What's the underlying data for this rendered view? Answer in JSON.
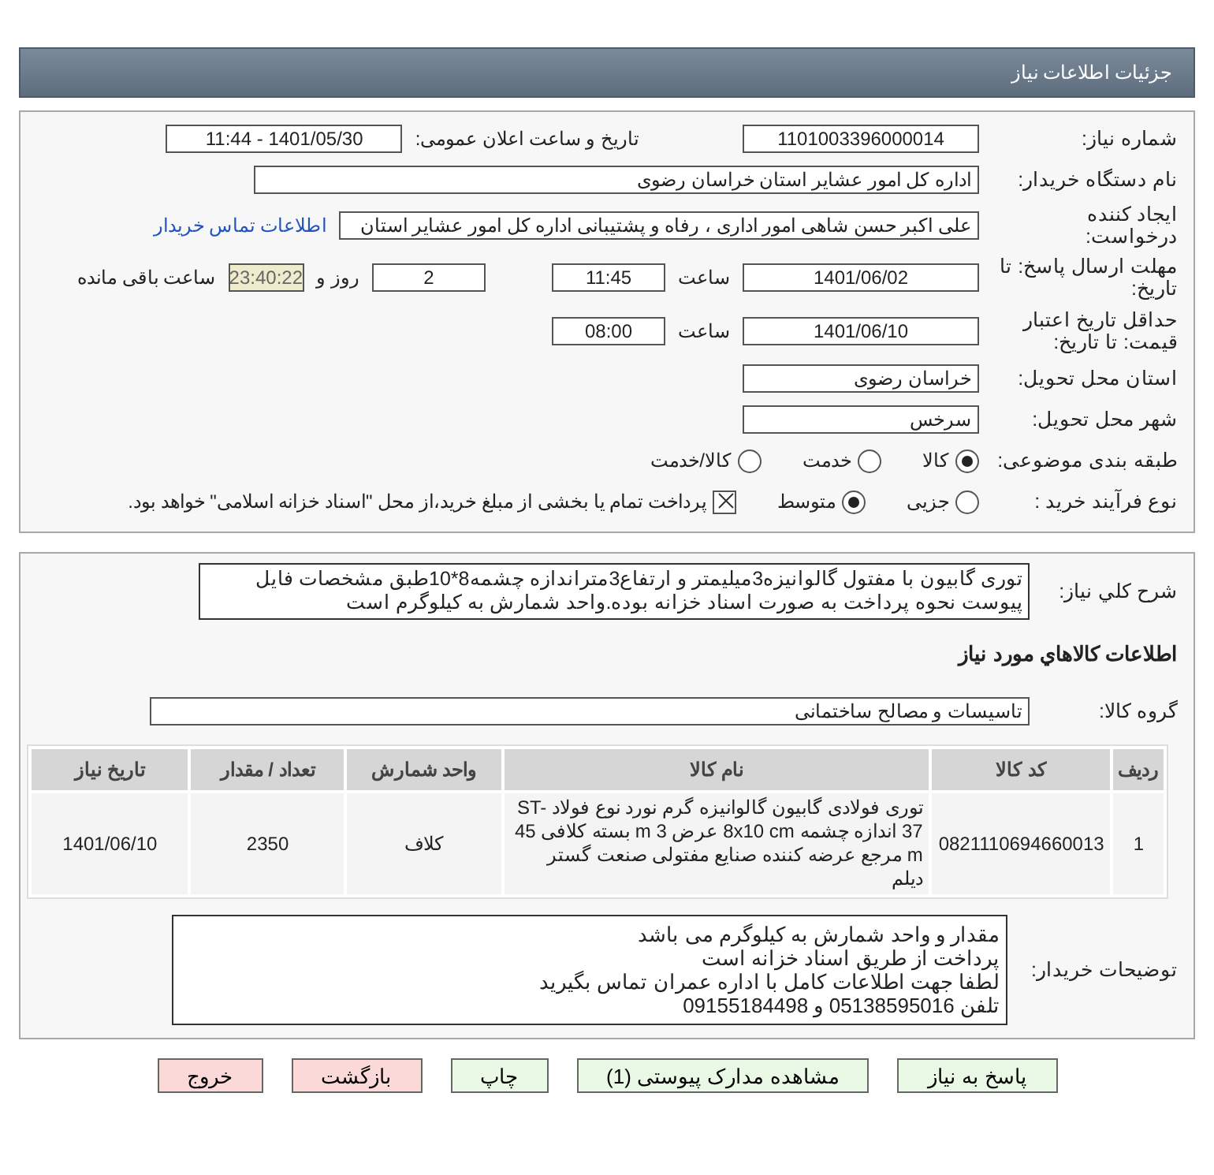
{
  "header": {
    "title": "جزئیات اطلاعات نیاز"
  },
  "details": {
    "need_number": {
      "label": "شماره نیاز:",
      "value": "1101003396000014"
    },
    "announce": {
      "label": "تاریخ و ساعت اعلان عمومی:",
      "value": "1401/05/30 - 11:44"
    },
    "buyer": {
      "label": "نام دستگاه خریدار:",
      "value": "اداره کل امور عشایر استان خراسان رضوی"
    },
    "creator": {
      "label": "ایجاد کننده درخواست:",
      "value": "علی اکبر حسن شاهی امور اداری ، رفاه و پشتیبانی اداره کل امور عشایر استان",
      "link": "اطلاعات تماس خریدار"
    },
    "deadline": {
      "label": "مهلت ارسال پاسخ: تا تاریخ:",
      "date": "1401/06/02",
      "time_label": "ساعت",
      "time": "11:45",
      "days": "2",
      "days_label": "روز و",
      "remaining": "23:40:22",
      "remaining_label": "ساعت باقی مانده"
    },
    "validity": {
      "label": "حداقل تاریخ اعتبار قیمت: تا تاریخ:",
      "date": "1401/06/10",
      "time_label": "ساعت",
      "time": "08:00"
    },
    "province": {
      "label": "استان محل تحویل:",
      "value": "خراسان رضوی"
    },
    "city": {
      "label": "شهر محل تحویل:",
      "value": "سرخس"
    },
    "category": {
      "label": "طبقه بندی موضوعی:",
      "options": [
        {
          "label": "کالا",
          "selected": true
        },
        {
          "label": "خدمت",
          "selected": false
        },
        {
          "label": "کالا/خدمت",
          "selected": false
        }
      ]
    },
    "process": {
      "label": "نوع فرآیند خرید :",
      "options": [
        {
          "label": "جزیی",
          "selected": false
        },
        {
          "label": "متوسط",
          "selected": true
        }
      ],
      "treasury": {
        "label": "پرداخت تمام یا بخشی از مبلغ خرید،از محل \"اسناد خزانه اسلامی\" خواهد بود.",
        "checked": true
      }
    }
  },
  "summary": {
    "label": "شرح کلي نیاز:",
    "value": "توری گابیون با مفتول گالوانیزه3میلیمتر و ارتفاع3متراندازه چشمه8*10طبق مشخصات فایل پیوست نحوه پرداخت به صورت اسناد خزانه بوده.واحد شمارش به کیلوگرم است"
  },
  "goods_heading": "اطلاعات كالاهاي مورد نياز",
  "goods_group": {
    "label": "گروه کالا:",
    "value": "تاسیسات و مصالح ساختمانی"
  },
  "table": {
    "columns": [
      "ردیف",
      "کد کالا",
      "نام کالا",
      "واحد شمارش",
      "تعداد / مقدار",
      "تاریخ نیاز"
    ],
    "rows": [
      [
        "1",
        "0821110694660013",
        "توری فولادی گابیون گالوانیزه گرم نورد نوع فولاد ST-37 اندازه چشمه 8x10 cm عرض 3 m بسته کلافی 45 m مرجع عرضه کننده صنایع مفتولی صنعت گستر دیلم",
        "کلاف",
        "2350",
        "1401/06/10"
      ]
    ]
  },
  "buyer_notes": {
    "label": "توضیحات خریدار:",
    "lines": [
      "مقدار و واحد شمارش به کیلوگرم می باشد",
      "پرداخت از طریق اسناد خزانه است",
      "لطفا جهت اطلاعات کامل با اداره عمران تماس بگیرید",
      "تلفن 05138595016 و 09155184498"
    ]
  },
  "buttons": [
    {
      "label": "پاسخ به نیاز",
      "kind": "normal"
    },
    {
      "label": "مشاهده مدارک پیوستی (1)",
      "kind": "normal"
    },
    {
      "label": "چاپ",
      "kind": "normal"
    },
    {
      "label": "بازگشت",
      "kind": "exit"
    },
    {
      "label": "خروج",
      "kind": "exit"
    }
  ]
}
